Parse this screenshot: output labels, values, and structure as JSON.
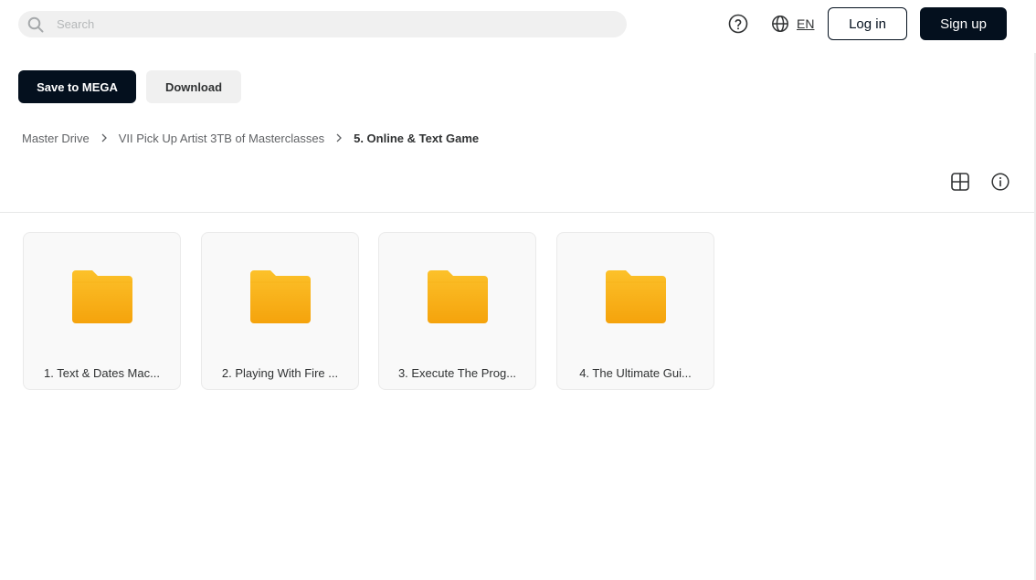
{
  "search": {
    "placeholder": "Search"
  },
  "header": {
    "language": "EN",
    "login_label": "Log in",
    "signup_label": "Sign up"
  },
  "actions": {
    "save_label": "Save to MEGA",
    "download_label": "Download"
  },
  "breadcrumb": [
    "Master Drive",
    "VII Pick Up Artist 3TB of Masterclasses",
    "5. Online & Text Game"
  ],
  "folders": [
    {
      "name": "1. Text & Dates Mac..."
    },
    {
      "name": "2. Playing With Fire ..."
    },
    {
      "name": "3. Execute The Prog..."
    },
    {
      "name": "4. The Ultimate Gui..."
    }
  ],
  "icons": {
    "search": "search-icon",
    "help": "help-icon",
    "language": "globe-icon",
    "view": "grid-view-icon",
    "info": "info-icon",
    "folder": "folder-icon"
  },
  "colors": {
    "primary_dark": "#04101e",
    "folder_top": "#fcc12a",
    "folder_bottom": "#f5a30c",
    "secondary_bg": "#f0f0f0"
  }
}
